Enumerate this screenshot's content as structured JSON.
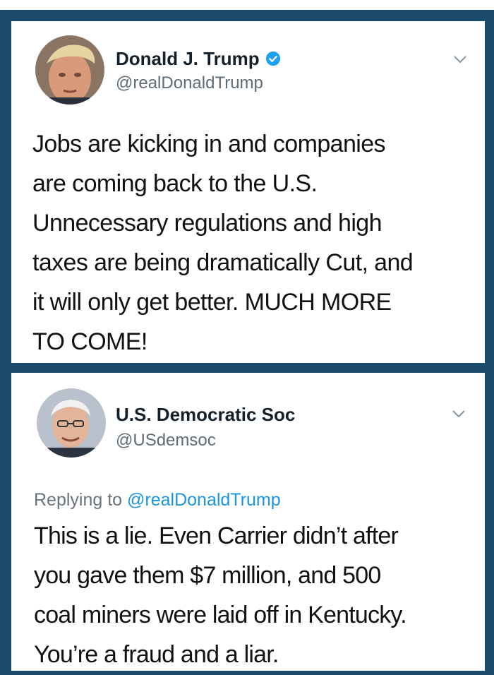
{
  "tweet1": {
    "name": "Donald J. Trump",
    "handle": "@realDonaldTrump",
    "lines": [
      "Jobs are kicking in and companies",
      "are coming back to the U.S.",
      "Unnecessary regulations and high",
      "taxes are being dramatically Cut, and",
      "it will only get better. MUCH MORE",
      "TO COME!"
    ],
    "verified": true,
    "icons": {
      "avatar": "avatar",
      "verified": "verified-badge-icon",
      "menu": "chevron-down-icon"
    }
  },
  "tweet2": {
    "name": "U.S. Democratic Soc",
    "handle": "@USdemsoc",
    "reply_prefix": "Replying to",
    "reply_to": "@realDonaldTrump",
    "lines": [
      "This is a lie. Even Carrier didn’t after",
      "you gave them $7 million, and 500",
      "coal miners were laid off in Kentucky.",
      "You’re a fraud and a liar."
    ],
    "icons": {
      "avatar": "avatar",
      "menu": "chevron-down-icon"
    }
  },
  "colors": {
    "frame": "#1b4a6b",
    "verified": "#1da1f2",
    "mention": "#1b95e0",
    "handle": "#5f6b76"
  }
}
